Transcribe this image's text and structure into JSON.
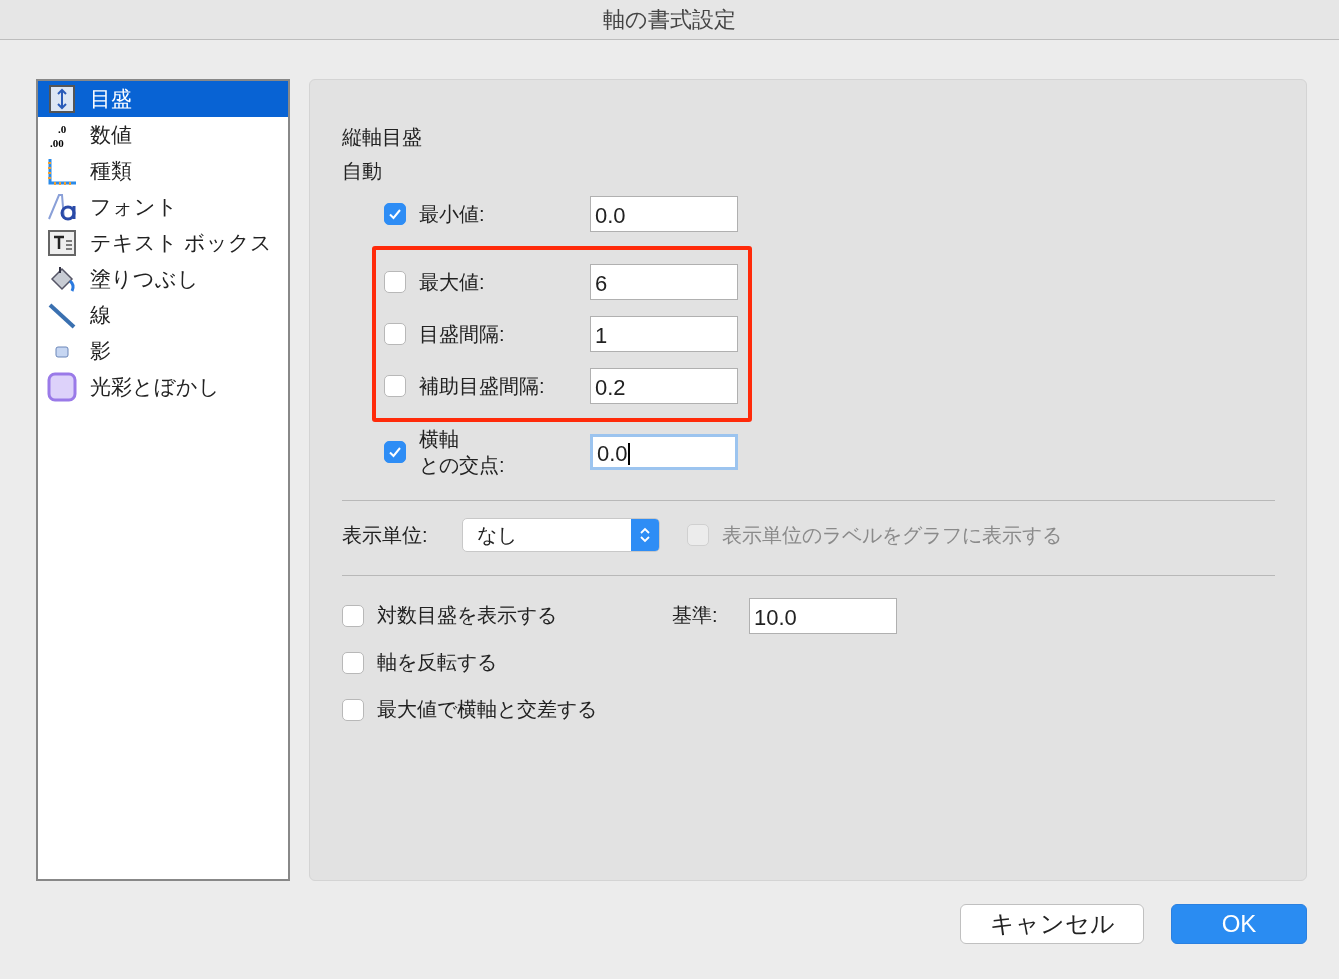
{
  "window": {
    "title": "軸の書式設定"
  },
  "sidebar": {
    "items": [
      {
        "label": "目盛",
        "selected": true
      },
      {
        "label": "数値",
        "selected": false,
        "icon_text": [
          ".0",
          ".00"
        ]
      },
      {
        "label": "種類",
        "selected": false
      },
      {
        "label": "フォント",
        "selected": false
      },
      {
        "label": "テキスト ボックス",
        "selected": false
      },
      {
        "label": "塗りつぶし",
        "selected": false
      },
      {
        "label": "線",
        "selected": false
      },
      {
        "label": "影",
        "selected": false
      },
      {
        "label": "光彩とぼかし",
        "selected": false
      }
    ]
  },
  "scale": {
    "heading": "縦軸目盛",
    "auto_label": "自動",
    "rows": [
      {
        "label_lines": [
          "最小値:"
        ],
        "checked": true,
        "value": "0.0",
        "focused": false,
        "highlighted": false
      },
      {
        "label_lines": [
          "最大値:"
        ],
        "checked": false,
        "value": "6",
        "focused": false,
        "highlighted": true
      },
      {
        "label_lines": [
          "目盛間隔:"
        ],
        "checked": false,
        "value": "1",
        "focused": false,
        "highlighted": true
      },
      {
        "label_lines": [
          "補助目盛間隔:"
        ],
        "checked": false,
        "value": "0.2",
        "focused": false,
        "highlighted": true
      },
      {
        "label_lines": [
          "横軸",
          "との交点:"
        ],
        "checked": true,
        "value": "0.0",
        "focused": true,
        "highlighted": false
      }
    ]
  },
  "units": {
    "label": "表示単位:",
    "value": "なし",
    "show_label": {
      "label": "表示単位のラベルをグラフに表示する",
      "checked": false,
      "disabled": true
    }
  },
  "options": [
    {
      "label": "対数目盛を表示する",
      "checked": false
    },
    {
      "label": "軸を反転する",
      "checked": false
    },
    {
      "label": "最大値で横軸と交差する",
      "checked": false
    }
  ],
  "base": {
    "label": "基準:",
    "value": "10.0"
  },
  "buttons": [
    {
      "label": "キャンセル",
      "kind": "secondary"
    },
    {
      "label": "OK",
      "kind": "primary"
    }
  ]
}
